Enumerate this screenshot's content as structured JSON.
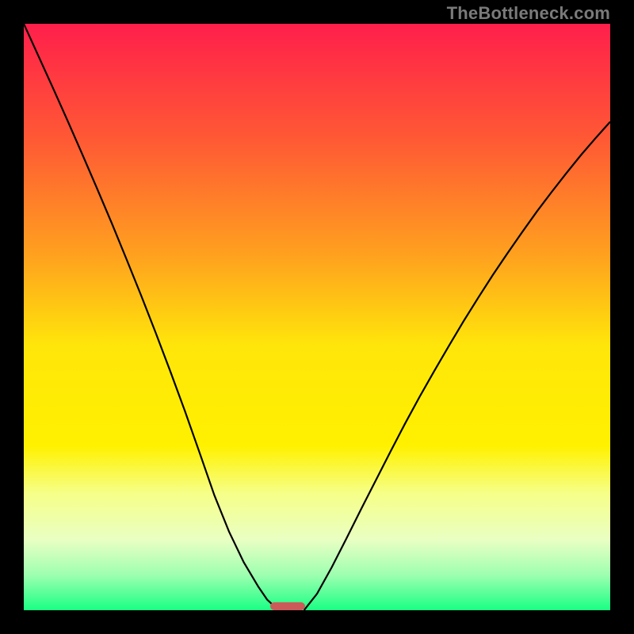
{
  "watermark": "TheBottleneck.com",
  "chart_data": {
    "type": "line",
    "title": "",
    "xlabel": "",
    "ylabel": "",
    "xlim": [
      0,
      100
    ],
    "ylim": [
      0,
      100
    ],
    "grid": false,
    "legend": false,
    "gradient_stops": [
      {
        "t": 0.0,
        "color": "#ff1f4b"
      },
      {
        "t": 0.2,
        "color": "#ff5a34"
      },
      {
        "t": 0.4,
        "color": "#ffa31e"
      },
      {
        "t": 0.55,
        "color": "#ffe60a"
      },
      {
        "t": 0.72,
        "color": "#fff100"
      },
      {
        "t": 0.8,
        "color": "#f6ff87"
      },
      {
        "t": 0.88,
        "color": "#e9ffc3"
      },
      {
        "t": 0.94,
        "color": "#9dffb0"
      },
      {
        "t": 1.0,
        "color": "#1aff84"
      }
    ],
    "series": [
      {
        "name": "left-branch",
        "x": [
          0.0,
          2.5,
          5.0,
          7.5,
          10.0,
          12.5,
          15.0,
          17.5,
          20.0,
          22.5,
          25.0,
          27.5,
          30.0,
          32.5,
          35.0,
          37.5,
          40.0,
          41.5,
          42.7,
          43.2
        ],
        "y": [
          100.0,
          94.5,
          89.0,
          83.4,
          77.7,
          71.9,
          66.0,
          59.9,
          53.7,
          47.3,
          40.7,
          33.9,
          26.8,
          19.6,
          13.4,
          8.2,
          4.0,
          1.8,
          0.7,
          0.0
        ]
      },
      {
        "name": "right-branch",
        "x": [
          47.8,
          48.5,
          50.0,
          52.5,
          55.0,
          57.5,
          60.0,
          62.5,
          65.0,
          67.5,
          70.0,
          72.5,
          75.0,
          77.5,
          80.0,
          82.5,
          85.0,
          87.5,
          90.0,
          92.5,
          95.0,
          97.5,
          100.0
        ],
        "y": [
          0.0,
          0.9,
          2.8,
          7.3,
          12.2,
          17.2,
          22.1,
          27.0,
          31.8,
          36.4,
          40.8,
          45.1,
          49.3,
          53.3,
          57.2,
          60.9,
          64.5,
          68.0,
          71.3,
          74.5,
          77.6,
          80.5,
          83.3
        ]
      }
    ],
    "marker": {
      "name": "bottleneck-zone",
      "x_start": 42.0,
      "x_end": 48.0,
      "y": 0.0,
      "height_pct": 1.4,
      "color": "#cc5a59"
    }
  }
}
